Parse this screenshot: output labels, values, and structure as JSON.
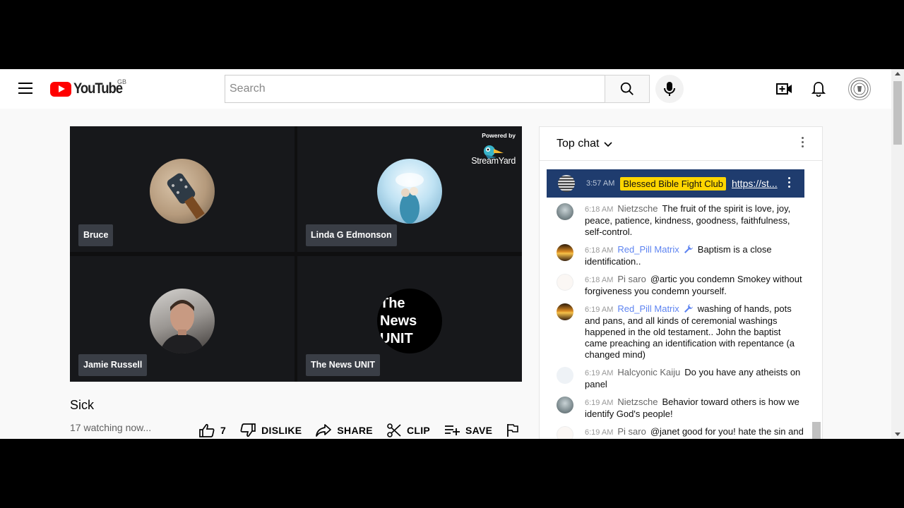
{
  "header": {
    "logo_text": "YouTube",
    "region": "GB",
    "search_placeholder": "Search"
  },
  "video": {
    "powered_by": "Powered by",
    "streamyard": "StreamYard",
    "participants": [
      {
        "name": "Bruce"
      },
      {
        "name": "Linda G Edmonson"
      },
      {
        "name": "Jamie Russell"
      },
      {
        "name": "The News UNIT",
        "logo_lines": [
          "The",
          "News",
          "UNIT"
        ]
      }
    ],
    "title": "Sick",
    "watching": "17 watching now...",
    "actions": {
      "likes": "7",
      "dislike": "DISLIKE",
      "share": "SHARE",
      "clip": "CLIP",
      "save": "SAVE"
    }
  },
  "chat": {
    "title": "Top chat",
    "pinned": {
      "time": "3:57 AM",
      "badge": "Blessed Bible Fight Club",
      "link": "https://st..."
    },
    "messages": [
      {
        "time": "6:18 AM",
        "author": "Nietzsche",
        "mod": false,
        "text": "The fruit of the spirit is love, joy, peace, patience, kindness, goodness, faithfulness, self-control."
      },
      {
        "time": "6:18 AM",
        "author": "Red_Pill Matrix",
        "mod": true,
        "text": "Baptism is a close identification.."
      },
      {
        "time": "6:18 AM",
        "author": "Pi saro",
        "mod": false,
        "text": "@artic you condemn Smokey without forgiveness you condemn yourself."
      },
      {
        "time": "6:19 AM",
        "author": "Red_Pill Matrix",
        "mod": true,
        "text": "washing of hands, pots and pans, and all kinds of ceremonial washings happened in the old testament.. John the baptist came preaching an identification with repentance (a changed mind)"
      },
      {
        "time": "6:19 AM",
        "author": "Halcyonic Kaiju",
        "mod": false,
        "text": "Do you have any atheists on panel"
      },
      {
        "time": "6:19 AM",
        "author": "Nietzsche",
        "mod": false,
        "text": "Behavior toward others is how we identify God's people!"
      },
      {
        "time": "6:19 AM",
        "author": "Pi saro",
        "mod": false,
        "text": "@janet good for you! hate the sin and Love the people"
      }
    ]
  },
  "colors": {
    "brand_red": "#ff0000",
    "pinned_bg": "#1f3c6e",
    "badge_yellow": "#ffd600",
    "moderator_blue": "#5e84f1"
  }
}
